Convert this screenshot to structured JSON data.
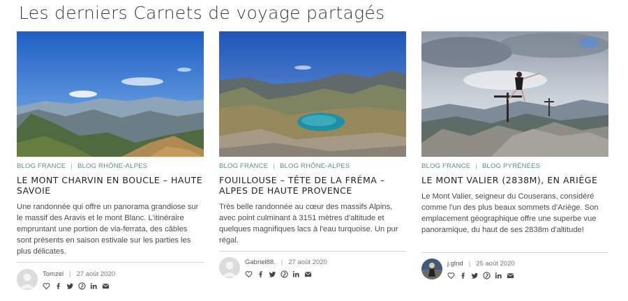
{
  "section": {
    "title": "Les derniers Carnets de voyage partagés"
  },
  "colors": {
    "category": "#5a8e8a",
    "title": "#222222",
    "text": "#4a4a4a"
  },
  "cards": [
    {
      "categories": [
        "BLOG FRANCE",
        "BLOG RHÔNE-ALPES"
      ],
      "title": "LE MONT CHARVIN EN BOUCLE – HAUTE SAVOIE",
      "excerpt": "Une randonnée qui offre un panorama grandiose sur le massif des Aravis et le mont Blanc. L'itinéraire empruntant une portion de via-ferrata, des câbles sont présents en saison estivale sur les parties les plus délicates.",
      "author": "Tomzel",
      "date": "27 août 2020",
      "image": "mountain-ridge-landscape",
      "avatar": "default-user-avatar"
    },
    {
      "categories": [
        "BLOG FRANCE",
        "BLOG RHÔNE-ALPES"
      ],
      "title": "FOUILLOUSE – TÊTE DE LA FRÉMA – ALPES DE HAUTE PROVENCE",
      "excerpt": "Très belle randonnée au cœur des massifs Alpins, avec point culminant à 3151 mètres d'altitude et quelques magnifiques lacs à l'eau turquoise. Un pur régal.",
      "author": "Gabriel88.",
      "date": "27 août 2020",
      "image": "alpine-lake-landscape",
      "avatar": "default-user-avatar"
    },
    {
      "categories": [
        "BLOG FRANCE",
        "BLOG PYRÉNÉES"
      ],
      "title": "LE MONT VALIER (2838M), EN ARIÈGE",
      "excerpt": "Le Mont Valier, seigneur du Couserans, considéré comme l'un des plus beaux sommets d'Ariège. Son emplacement géographique offre une superbe vue panoramique, du haut de ses 2838m d'altitude!",
      "author": "j.glnd",
      "date": "25 août 2020",
      "image": "summit-hiker-landscape",
      "avatar": "user-photo-avatar"
    }
  ],
  "share_icons": [
    "heart-icon",
    "facebook-icon",
    "twitter-icon",
    "pinterest-icon",
    "linkedin-icon",
    "email-icon"
  ]
}
